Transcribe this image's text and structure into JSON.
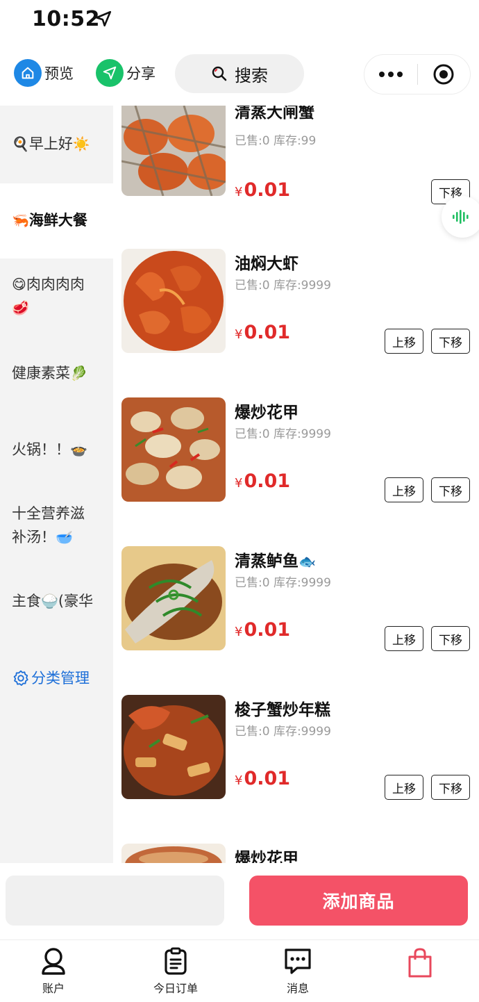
{
  "status_bar": {
    "time": "10:52"
  },
  "topbar": {
    "preview_label": "预览",
    "share_label": "分享",
    "search_label": "搜索"
  },
  "sidebar": {
    "items": [
      {
        "text": "早上好",
        "prefix_icon": "magnifier-emoji",
        "suffix_icon": "sun-emoji"
      },
      {
        "text": "海鲜大餐",
        "prefix_icon": "shrimp-emoji"
      },
      {
        "text": "肉肉肉肉",
        "prefix_icon": "smile-emoji",
        "suffix_icon": "steak-emoji"
      },
      {
        "text": "健康素菜",
        "suffix_icon": "leafy-green-emoji"
      },
      {
        "text": "火锅！！",
        "suffix_icon": "hotpot-emoji"
      },
      {
        "line1": "十全营养滋",
        "line2": "补汤！",
        "suffix_icon": "soup-bowl-emoji"
      },
      {
        "text": "主食",
        "suffix_icon": "rice-bowl-emoji",
        "tail": "(豪华"
      }
    ],
    "manage_label": "分类管理"
  },
  "products": [
    {
      "name": "清蒸大闸蟹",
      "meta": "已售:0 库存:99",
      "price_symbol": "¥",
      "price": "0.01",
      "up_label": "",
      "down_label": "下移"
    },
    {
      "name": "油焖大虾",
      "meta": "已售:0 库存:9999",
      "price_symbol": "¥",
      "price": "0.01",
      "up_label": "上移",
      "down_label": "下移"
    },
    {
      "name": "爆炒花甲",
      "meta": "已售:0 库存:9999",
      "price_symbol": "¥",
      "price": "0.01",
      "up_label": "上移",
      "down_label": "下移"
    },
    {
      "name": "清蒸鲈鱼",
      "meta": "已售:0 库存:9999",
      "price_symbol": "¥",
      "price": "0.01",
      "up_label": "上移",
      "down_label": "下移",
      "name_icon": "fish-emoji"
    },
    {
      "name": "梭子蟹炒年糕",
      "meta": "已售:0 库存:9999",
      "price_symbol": "¥",
      "price": "0.01",
      "up_label": "上移",
      "down_label": "下移"
    },
    {
      "name": "爆炒花甲"
    }
  ],
  "actions": {
    "add_label": "添加商品"
  },
  "tabbar": {
    "tabs": [
      {
        "label": "账户",
        "icon": "person-icon"
      },
      {
        "label": "今日订单",
        "icon": "clipboard-icon"
      },
      {
        "label": "消息",
        "icon": "message-icon"
      },
      {
        "label": "",
        "icon": "shopping-bag-icon"
      }
    ]
  },
  "colors": {
    "accent": "#f45267",
    "price": "#e02a2a",
    "link": "#1d6fd8"
  }
}
